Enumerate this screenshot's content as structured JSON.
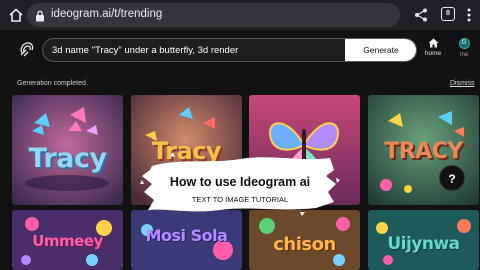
{
  "browser": {
    "url": "ideogram.ai/t/trending",
    "tab_count": "8"
  },
  "app": {
    "prompt": "3d name \"Tracy\" under a butterfly, 3d render",
    "generate_label": "Generate",
    "nav_home_label": "home",
    "nav_me_label": "me",
    "avatar_initial": "G"
  },
  "status": {
    "message": "Generation completed",
    "dismiss_label": "Dismiss"
  },
  "overlay": {
    "title": "How to use Ideogram ai",
    "subtitle": "TEXT TO IMAGE TUTORIAL"
  },
  "help_label": "?",
  "tiles": [
    {
      "word": "Tracy",
      "bg": "#7c4a6e",
      "text_color": "#8fd8f5"
    },
    {
      "word": "Tracy",
      "bg": "#8a5a4a",
      "text_color": "#f4c04a"
    },
    {
      "word": "",
      "bg": "#b8587a",
      "text_color": "#d98ad8"
    },
    {
      "word": "TRACY",
      "bg": "#2f5a4a",
      "text_color": "#e88a5a"
    },
    {
      "word": "Ummeey",
      "bg": "#5a3e7a",
      "text_color": "#ff5fa8"
    },
    {
      "word": "Mosi Sola",
      "bg": "#3e3a7a",
      "text_color": "#b08cff"
    },
    {
      "word": "chison",
      "bg": "#6a4a2a",
      "text_color": "#ffb54a"
    },
    {
      "word": "Uijynwa",
      "bg": "#1e5a5a",
      "text_color": "#6ad6d0"
    }
  ]
}
